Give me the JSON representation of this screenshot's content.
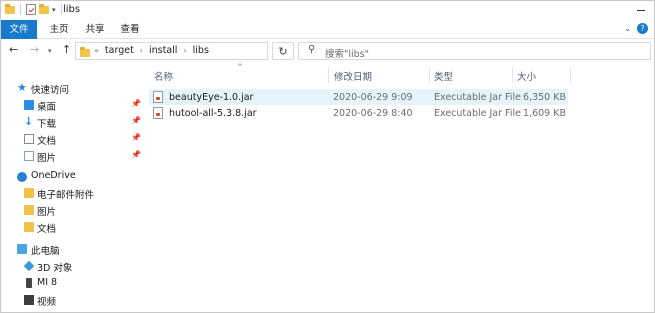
{
  "window": {
    "title": "libs"
  },
  "ribbon": {
    "tabs": [
      "文件",
      "主页",
      "共享",
      "查看"
    ]
  },
  "navigation": {
    "breadcrumb": [
      "target",
      "install",
      "libs"
    ],
    "breadcrumb_prefix": "«",
    "search_placeholder": "搜索\"libs\""
  },
  "sidebar": {
    "quick_access": "快速访问",
    "quick_items": [
      "桌面",
      "下载",
      "文档",
      "图片"
    ],
    "onedrive": "OneDrive",
    "onedrive_items": [
      "电子邮件附件",
      "图片",
      "文档"
    ],
    "this_pc": "此电脑",
    "pc_items": [
      "3D 对象",
      "MI 8",
      "视频"
    ]
  },
  "columns": {
    "name": "名称",
    "date": "修改日期",
    "type": "类型",
    "size": "大小"
  },
  "files": [
    {
      "name": "beautyEye-1.0.jar",
      "date": "2020-06-29 9:09",
      "type": "Executable Jar File",
      "size": "6,350 KB",
      "selected": true
    },
    {
      "name": "hutool-all-5.3.8.jar",
      "date": "2020-06-29 8:40",
      "type": "Executable Jar File",
      "size": "1,609 KB",
      "selected": false
    }
  ],
  "colors": {
    "accent": "#1979ca",
    "selection": "#e5f3fb",
    "header_text": "#4c607a"
  }
}
